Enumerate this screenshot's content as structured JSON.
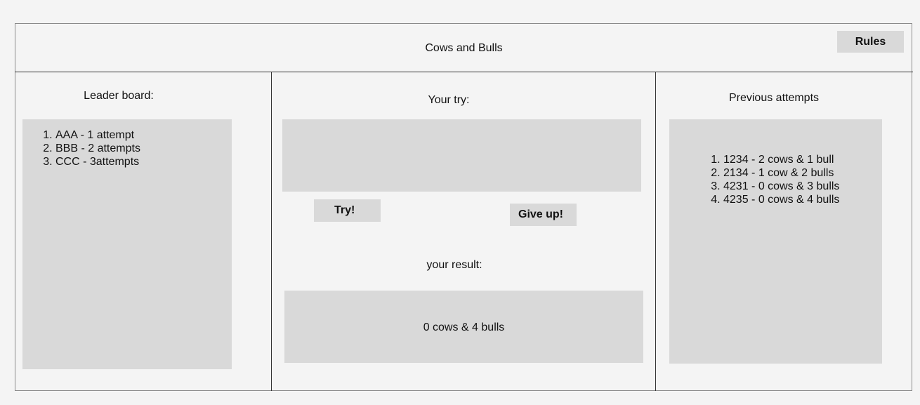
{
  "header": {
    "title": "Cows and Bulls",
    "rules_label": "Rules"
  },
  "leaderboard": {
    "heading": "Leader board:",
    "entries": [
      "AAA - 1 attempt",
      "BBB - 2 attempts",
      "CCC - 3attempts"
    ]
  },
  "play": {
    "try_heading": "Your try:",
    "try_input_value": "",
    "try_label": "Try!",
    "give_up_label": "Give up!",
    "result_heading": "your result:",
    "result_value": "0 cows & 4 bulls"
  },
  "previous": {
    "heading": "Previous attempts",
    "entries": [
      "1234 - 2 cows & 1 bull",
      "2134 - 1 cow & 2 bulls",
      "4231 - 0 cows & 3 bulls",
      "4235 - 0 cows & 4 bulls"
    ]
  }
}
